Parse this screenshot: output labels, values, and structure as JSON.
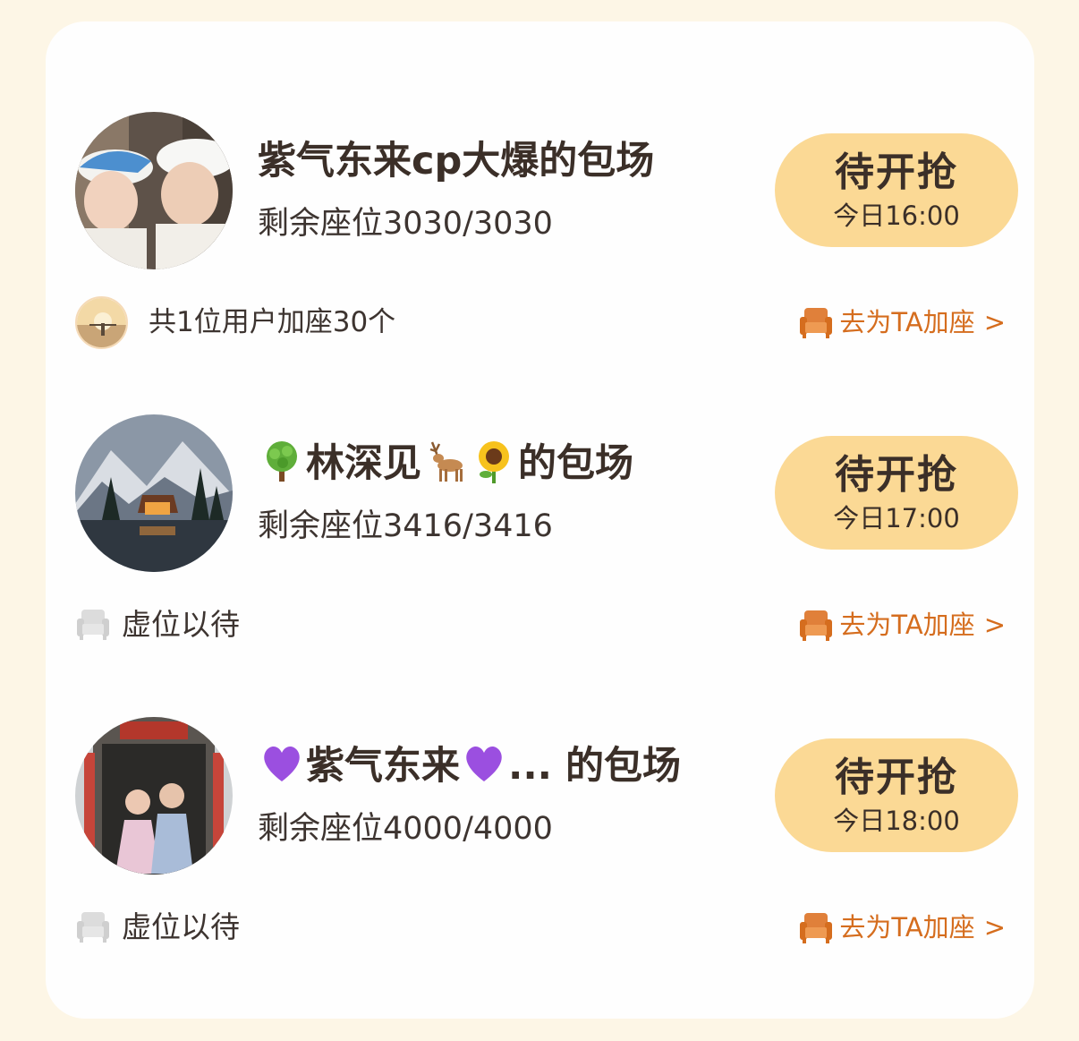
{
  "rooms": [
    {
      "title": "紫气东来cp大爆的包场",
      "seats": "剩余座位3030/3030",
      "button_label": "待开抢",
      "button_time": "今日16:00",
      "footer_text": "共1位用户加座30个",
      "link_text": "去为TA加座",
      "link_chevron": ">"
    },
    {
      "title_parts": [
        "林深见",
        "的包场"
      ],
      "seats": "剩余座位3416/3416",
      "button_label": "待开抢",
      "button_time": "今日17:00",
      "footer_text": "虚位以待",
      "link_text": "去为TA加座",
      "link_chevron": ">"
    },
    {
      "title_parts": [
        "紫气东来",
        "... 的包场"
      ],
      "seats": "剩余座位4000/4000",
      "button_label": "待开抢",
      "button_time": "今日18:00",
      "footer_text": "虚位以待",
      "link_text": "去为TA加座",
      "link_chevron": ">"
    }
  ],
  "colors": {
    "page_bg": "#fdf6e6",
    "card_bg": "#fefefe",
    "button_bg": "#fbd995",
    "accent_orange": "#d56d1e",
    "text_dark": "#3b2f28"
  },
  "icons": {
    "sofa": "sofa-icon",
    "gray_sofa": "gray-sofa-icon",
    "tree": "tree-emoji",
    "deer": "deer-emoji",
    "sunflower": "sunflower-emoji",
    "heart": "purple-heart-emoji"
  }
}
